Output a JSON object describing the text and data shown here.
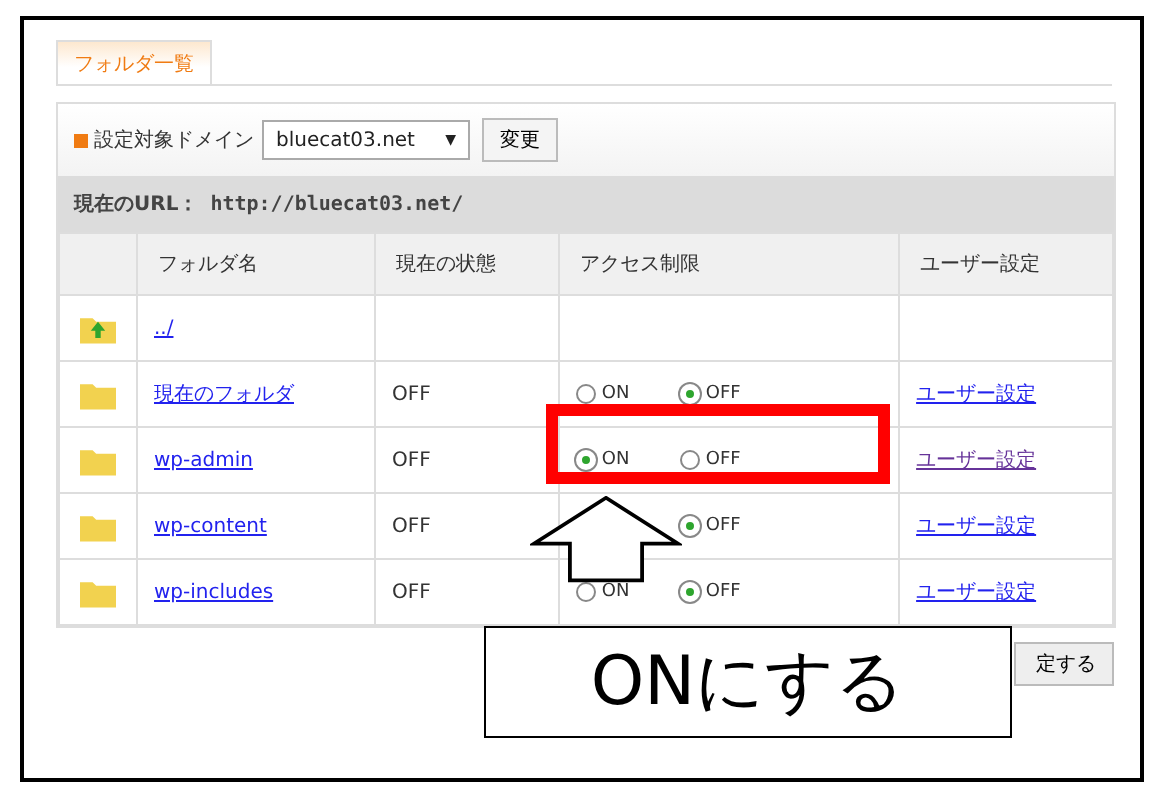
{
  "tabs": [
    {
      "label": "フォルダ一覧",
      "selected": true
    }
  ],
  "domain": {
    "label": "設定対象ドメイン",
    "value": "bluecat03.net",
    "button": "変更",
    "caret": "▼"
  },
  "url_bar": {
    "label": "現在のURL：",
    "url": "http://bluecat03.net/"
  },
  "table": {
    "columns": [
      "フォルダ名",
      "現在の状態",
      "アクセス制限",
      "ユーザー設定"
    ],
    "rows": [
      {
        "kind": "parent",
        "name": "../"
      },
      {
        "kind": "folder",
        "name": "現在のフォルダ",
        "state": "OFF",
        "access": {
          "on": {
            "label": "ON",
            "selected": false
          },
          "off": {
            "label": "OFF",
            "selected": true
          }
        },
        "user": {
          "label": "ユーザー設定",
          "visited": false
        }
      },
      {
        "kind": "folder",
        "name": "wp-admin",
        "state": "OFF",
        "access": {
          "on": {
            "label": "ON",
            "selected": true
          },
          "off": {
            "label": "OFF",
            "selected": false
          }
        },
        "user": {
          "label": "ユーザー設定",
          "visited": true
        }
      },
      {
        "kind": "folder",
        "name": "wp-content",
        "state": "OFF",
        "access": {
          "off": {
            "label": "OFF",
            "selected": true
          }
        },
        "user": {
          "label": "ユーザー設定",
          "visited": false
        }
      },
      {
        "kind": "folder",
        "name": "wp-includes",
        "state": "OFF",
        "access": {
          "on": {
            "label": "ON",
            "selected": false
          },
          "off": {
            "label": "OFF",
            "selected": true
          }
        },
        "user": {
          "label": "ユーザー設定",
          "visited": false
        }
      }
    ]
  },
  "submit_button": "定する",
  "callout": "ONにする"
}
